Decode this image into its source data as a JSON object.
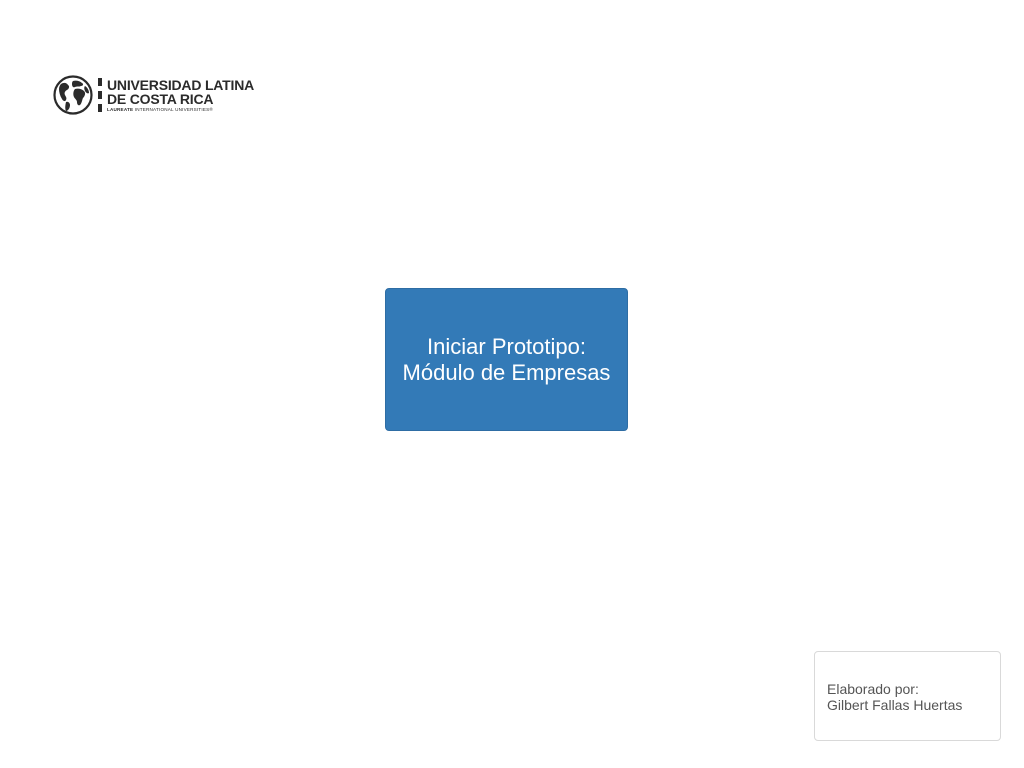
{
  "logo": {
    "name_line1": "UNIVERSIDAD LATINA",
    "name_line2": "DE COSTA RICA",
    "tagline_bold": "LAUREATE",
    "tagline_rest": " INTERNATIONAL UNIVERSITIES®",
    "icon": "globe-icon"
  },
  "start_button": {
    "line1": "Iniciar Prototipo:",
    "line2": "Módulo de Empresas",
    "color": "#337ab7"
  },
  "author_card": {
    "label": "Elaborado por:",
    "name": "Gilbert Fallas Huertas"
  }
}
